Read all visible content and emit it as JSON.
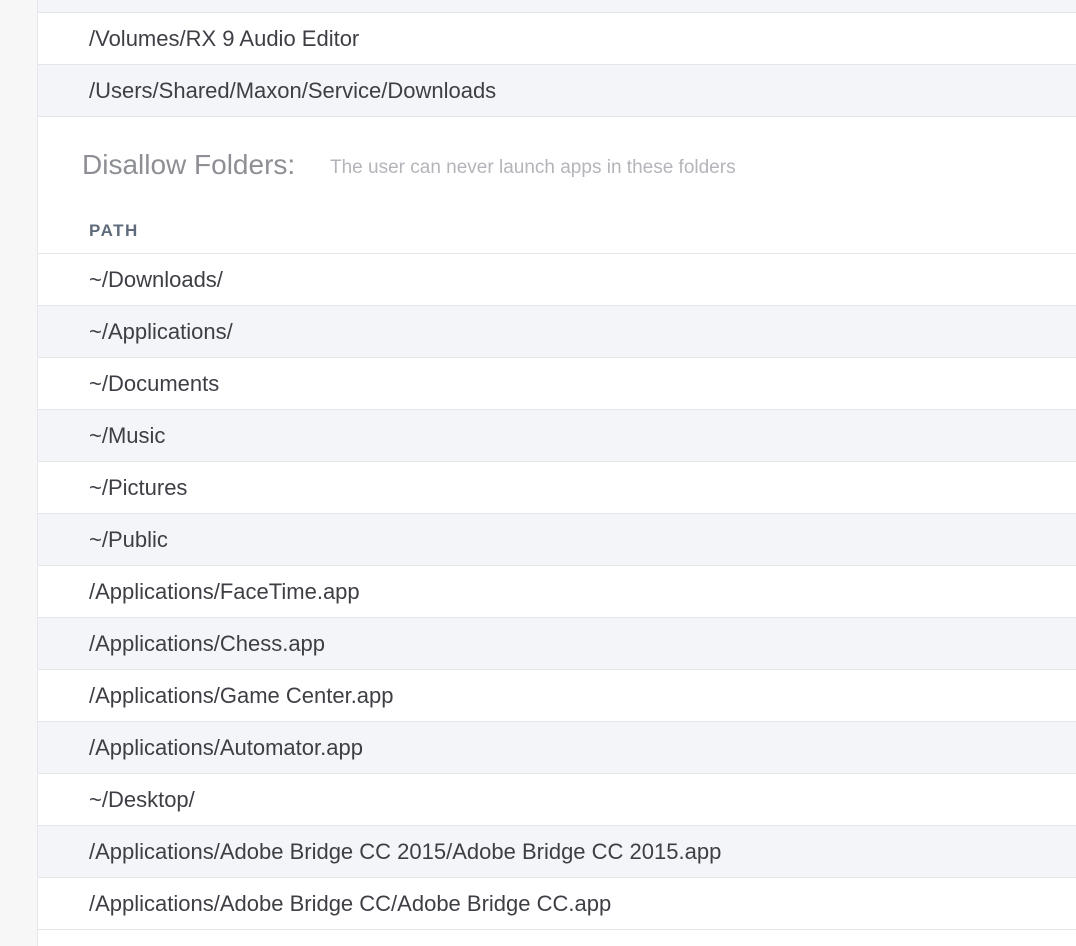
{
  "allow_folders": {
    "rows": [
      "/Volumes/RX 9 Audio Editor",
      "/Users/Shared/Maxon/Service/Downloads"
    ]
  },
  "disallow_folders": {
    "title": "Disallow Folders:",
    "description": "The user can never launch apps in these folders",
    "column_header": "PATH",
    "rows": [
      "~/Downloads/",
      "~/Applications/",
      "~/Documents",
      "~/Music",
      "~/Pictures",
      "~/Public",
      "/Applications/FaceTime.app",
      "/Applications/Chess.app",
      "/Applications/Game Center.app",
      "/Applications/Automator.app",
      "~/Desktop/",
      "/Applications/Adobe Bridge CC 2015/Adobe Bridge CC 2015.app",
      "/Applications/Adobe Bridge CC/Adobe Bridge CC.app"
    ]
  }
}
